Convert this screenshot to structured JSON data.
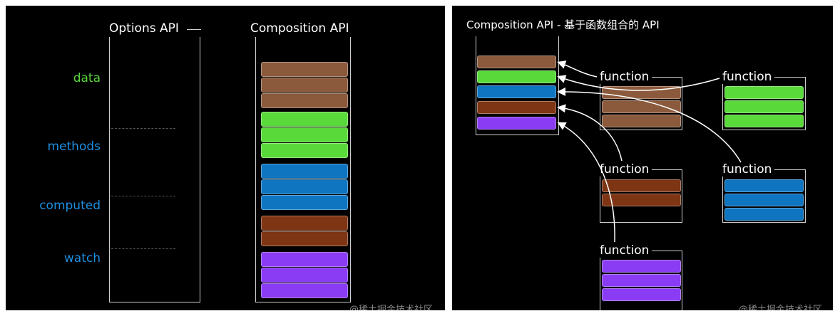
{
  "left": {
    "options_title": "Options API",
    "composition_title": "Composition API",
    "labels": [
      {
        "key": "data",
        "text": "data",
        "color": "#58d63b"
      },
      {
        "key": "methods",
        "text": "methods",
        "color": "#1f8fe0"
      },
      {
        "key": "computed",
        "text": "computed",
        "color": "#1f8fe0"
      },
      {
        "key": "watch",
        "text": "watch",
        "color": "#1f8fe0"
      }
    ],
    "watermark": "@稀土掘金技术社区"
  },
  "right": {
    "title": "Composition API - 基于函数组合的 API",
    "function_label": "function",
    "watermark": "@稀土掘金技术社区"
  },
  "colors": {
    "brown": "#8b5a3c",
    "green": "#5ad93b",
    "blue": "#0f75c0",
    "rust": "#7d3514",
    "purple": "#8a3cf5",
    "background": "#000000",
    "border": "#cfcfcf"
  }
}
